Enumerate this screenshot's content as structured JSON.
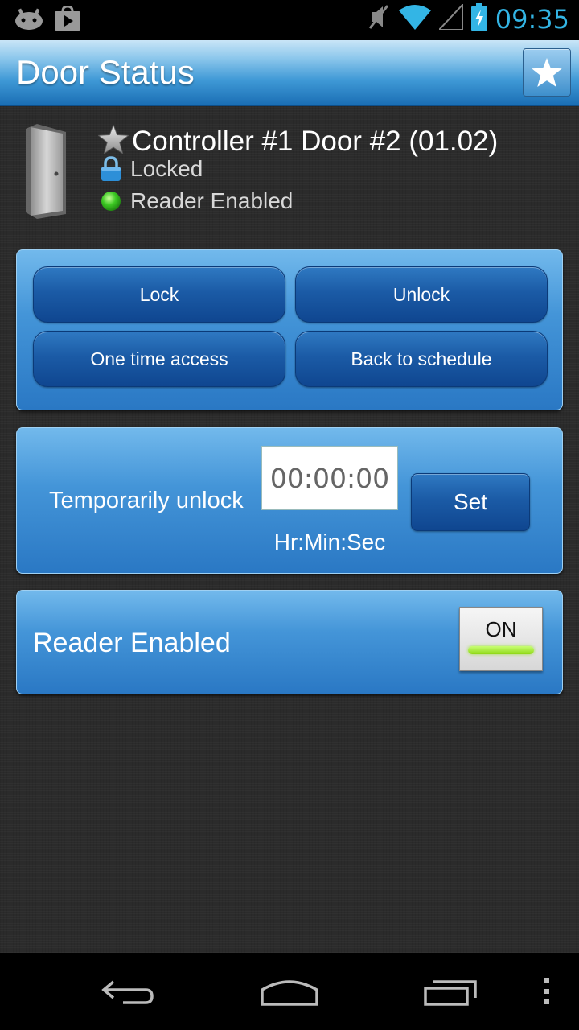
{
  "status_bar": {
    "time": "09:35",
    "icons": [
      "android-notification-icon",
      "play-store-icon",
      "muted-icon",
      "wifi-icon",
      "signal-icon",
      "battery-charging-icon"
    ]
  },
  "action_bar": {
    "title": "Door Status",
    "favorite_icon": "star-icon"
  },
  "door": {
    "title": "Controller #1 Door #2 (01.02)",
    "lock_status": "Locked",
    "reader_status": "Reader Enabled"
  },
  "controls": {
    "lock_label": "Lock",
    "unlock_label": "Unlock",
    "one_time_label": "One time access",
    "schedule_label": "Back to schedule"
  },
  "temp_unlock": {
    "label": "Temporarily unlock",
    "time_value": "00:00:00",
    "format_label": "Hr:Min:Sec",
    "set_label": "Set"
  },
  "reader": {
    "label": "Reader Enabled",
    "toggle_label": "ON",
    "toggle_on": true,
    "accent": "#9fe23b"
  },
  "colors": {
    "clock": "#33b5e5",
    "panel_blue": "#4495d8",
    "button_blue": "#1b5ba6"
  }
}
